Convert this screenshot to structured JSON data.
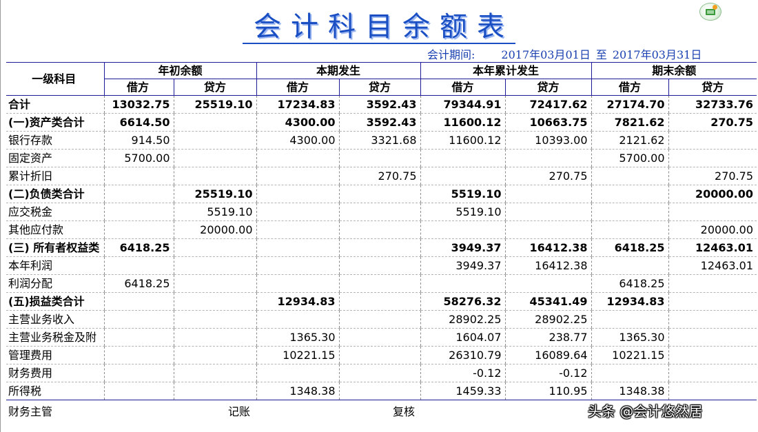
{
  "report": {
    "title": "会计科目余额表",
    "period_label": "会计期间:",
    "period_start": "2017年03月01日",
    "period_sep": "至",
    "period_end": "2017年03月31日"
  },
  "header": {
    "account": "一级科目",
    "groups": [
      "年初余额",
      "本期发生",
      "本年累计发生",
      "期末余额"
    ],
    "sub": [
      "借方",
      "贷方",
      "借方",
      "贷方",
      "借方",
      "贷方",
      "借方",
      "贷方"
    ]
  },
  "rows": [
    {
      "name": "合计",
      "bold": true,
      "v": [
        "13032.75",
        "25519.10",
        "17234.83",
        "3592.43",
        "79344.91",
        "72417.62",
        "27174.70",
        "32733.76"
      ]
    },
    {
      "name": "(一)资产类合计",
      "bold": true,
      "v": [
        "6614.50",
        "",
        "4300.00",
        "3592.43",
        "11600.12",
        "10663.75",
        "7821.62",
        "270.75"
      ]
    },
    {
      "name": "银行存款",
      "bold": false,
      "v": [
        "914.50",
        "",
        "4300.00",
        "3321.68",
        "11600.12",
        "10393.00",
        "2121.62",
        ""
      ]
    },
    {
      "name": "固定资产",
      "bold": false,
      "v": [
        "5700.00",
        "",
        "",
        "",
        "",
        "",
        "5700.00",
        ""
      ]
    },
    {
      "name": "累计折旧",
      "bold": false,
      "v": [
        "",
        "",
        "",
        "270.75",
        "",
        "270.75",
        "",
        "270.75"
      ]
    },
    {
      "name": "(二)负债类合计",
      "bold": true,
      "v": [
        "",
        "25519.10",
        "",
        "",
        "5519.10",
        "",
        "",
        "20000.00"
      ]
    },
    {
      "name": "应交税金",
      "bold": false,
      "v": [
        "",
        "5519.10",
        "",
        "",
        "5519.10",
        "",
        "",
        ""
      ]
    },
    {
      "name": "其他应付款",
      "bold": false,
      "v": [
        "",
        "20000.00",
        "",
        "",
        "",
        "",
        "",
        "20000.00"
      ]
    },
    {
      "name": "(三) 所有者权益类",
      "bold": true,
      "v": [
        "6418.25",
        "",
        "",
        "",
        "3949.37",
        "16412.38",
        "6418.25",
        "12463.01"
      ]
    },
    {
      "name": "本年利润",
      "bold": false,
      "v": [
        "",
        "",
        "",
        "",
        "3949.37",
        "16412.38",
        "",
        "12463.01"
      ]
    },
    {
      "name": "利润分配",
      "bold": false,
      "v": [
        "6418.25",
        "",
        "",
        "",
        "",
        "",
        "6418.25",
        ""
      ]
    },
    {
      "name": "(五)损益类合计",
      "bold": true,
      "v": [
        "",
        "",
        "12934.83",
        "",
        "58276.32",
        "45341.49",
        "12934.83",
        ""
      ]
    },
    {
      "name": "主营业务收入",
      "bold": false,
      "v": [
        "",
        "",
        "",
        "",
        "28902.25",
        "28902.25",
        "",
        ""
      ]
    },
    {
      "name": "主营业务税金及附",
      "bold": false,
      "v": [
        "",
        "",
        "1365.30",
        "",
        "1604.07",
        "238.77",
        "1365.30",
        ""
      ]
    },
    {
      "name": "管理费用",
      "bold": false,
      "v": [
        "",
        "",
        "10221.15",
        "",
        "26310.79",
        "16089.64",
        "10221.15",
        ""
      ]
    },
    {
      "name": "财务费用",
      "bold": false,
      "v": [
        "",
        "",
        "",
        "",
        "-0.12",
        "-0.12",
        "",
        ""
      ]
    },
    {
      "name": "所得税",
      "bold": false,
      "v": [
        "",
        "",
        "1348.38",
        "",
        "1459.33",
        "110.95",
        "1348.38",
        ""
      ]
    }
  ],
  "footer": {
    "finance_supervisor": "财务主管",
    "bookkeeper": "记账",
    "reviewer": "复核"
  },
  "watermark": "头条 @会计悠然居",
  "colors": {
    "title": "#1a4fc4",
    "period": "#1a40b0",
    "grid_border": "#1b1b9a"
  }
}
